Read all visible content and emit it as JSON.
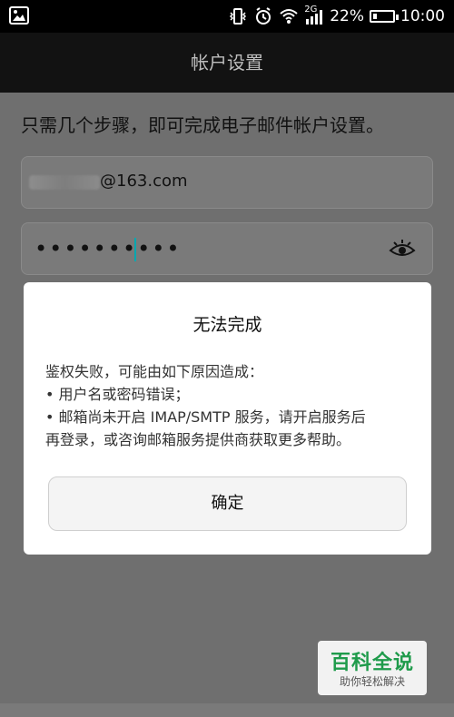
{
  "status_bar": {
    "time": "10:00",
    "battery_percent": "22%",
    "battery_level": 0.22,
    "network_label": "2G"
  },
  "app_bar": {
    "title": "帐户设置"
  },
  "main": {
    "instruction": "只需几个步骤，即可完成电子邮件帐户设置。",
    "email_value": "@163.com",
    "password_value": "••••••••••"
  },
  "dialog": {
    "title": "无法完成",
    "message": [
      "鉴权失败，可能由如下原因造成：",
      "• 用户名或密码错误；",
      "• 邮箱尚未开启 IMAP/SMTP 服务，请开启服务后",
      "再登录，或咨询邮箱服务提供商获取更多帮助。"
    ],
    "confirm_label": "确定"
  },
  "watermark": {
    "title": "百科全说",
    "subtitle": "助你轻松解决"
  }
}
